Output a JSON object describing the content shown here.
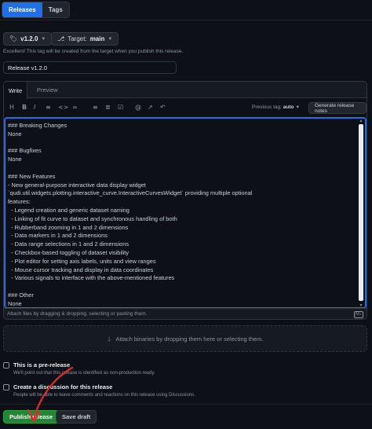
{
  "tabs": [
    {
      "label": "Releases"
    },
    {
      "label": "Tags"
    }
  ],
  "tag_button": {
    "label": "v1.2.0"
  },
  "target_button": {
    "prefix": "Target:",
    "branch": "main"
  },
  "tag_hint": "Excellent! This tag will be created from the target when you publish this release.",
  "release_title": "Release v1.2.0",
  "editor": {
    "tabs": [
      "Write",
      "Preview"
    ],
    "previous_tag_label": "Previous tag:",
    "previous_tag_value": "auto",
    "generate_button": "Generate release notes",
    "body_lines": [
      "### Breaking Changes",
      "None",
      "",
      "### Bugfixes",
      "None",
      "",
      "### New Features",
      "- New general-purpose interactive data display widget",
      "`qudi.util.widgets.plotting.interactive_curve.InteractiveCurvesWidget` providing multiple optional",
      "features:",
      "  - Legend creation and generic dataset naming",
      "  - Linking of fit curve to dataset and synchronous handling of both",
      "  - Rubberband zooming in 1 and 2 dimensions",
      "  - Data markers in 1 and 2 dimensions",
      "  - Data range selections in 1 and 2 dimensions",
      "  - Checkbox-based toggling of dataset visibility",
      "  - Plot editor for setting axis labels, units and view ranges",
      "  - Mouse cursor tracking and display in data coordinates",
      "  - Various signals to interface with the above-mentioned features",
      "",
      "### Other",
      "None"
    ],
    "attach_hint": "Attach files by dragging & dropping, selecting or pasting them."
  },
  "binaries_hint": "Attach binaries by dropping them here or selecting them.",
  "prerelease": {
    "title": "This is a pre-release",
    "desc": "We'll point out that this release is identified as non-production ready."
  },
  "discussion": {
    "title": "Create a discussion for this release",
    "desc": "People will be able to leave comments and reactions on this release using Discussions."
  },
  "actions": {
    "publish": "Publish release",
    "save_draft": "Save draft"
  },
  "colors": {
    "accent": "#1f6feb",
    "publish": "#238636",
    "annotation_arrow": "#e5262f"
  }
}
